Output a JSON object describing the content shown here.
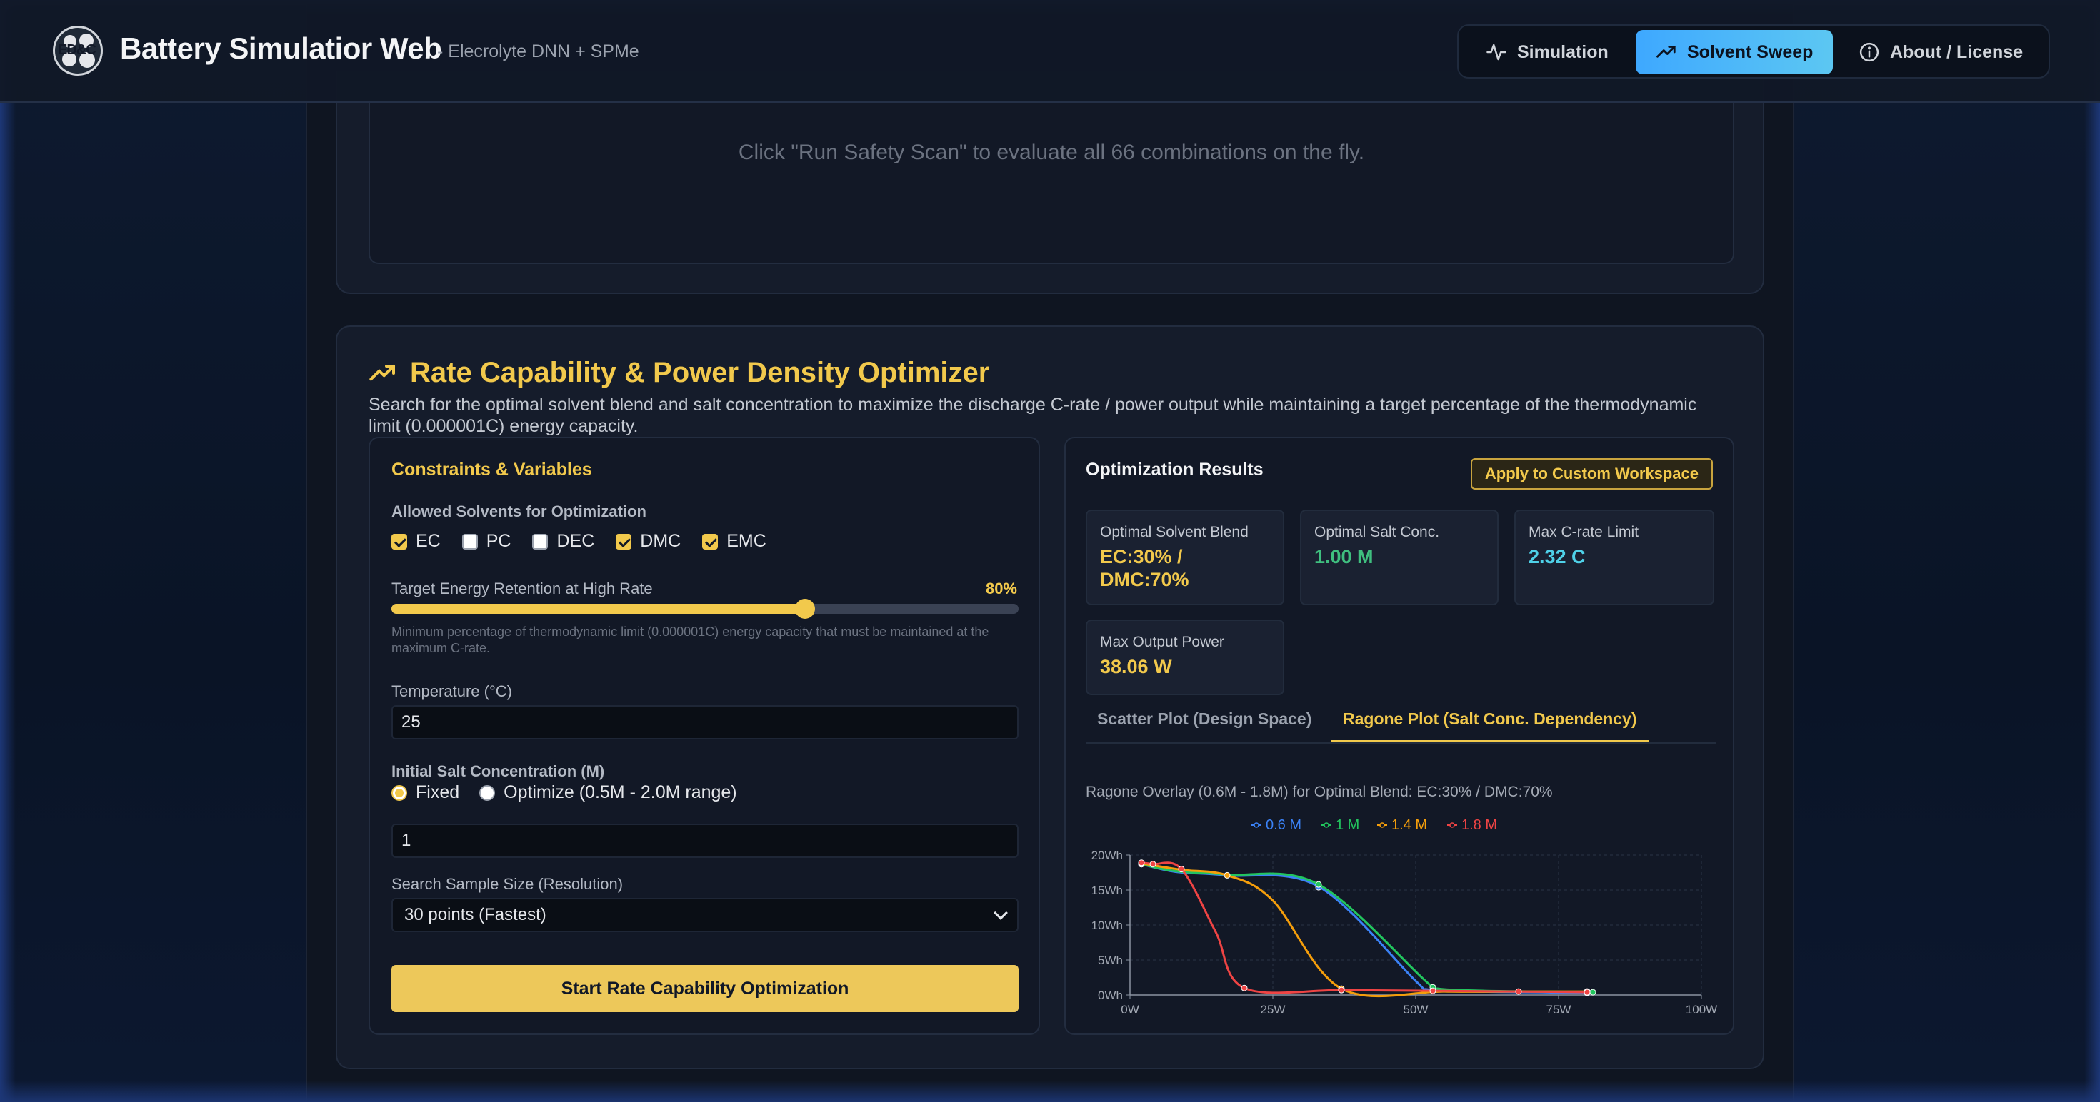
{
  "header": {
    "title": "Battery Simulatior Web",
    "subtitle": "- Elecrolyte DNN + SPMe",
    "logo_text": "ED&C"
  },
  "nav": [
    {
      "label": "Simulation",
      "icon": "pulse-icon",
      "active": false
    },
    {
      "label": "Solvent Sweep",
      "icon": "trend-up-icon",
      "active": true
    },
    {
      "label": "About / License",
      "icon": "info-icon",
      "active": false
    }
  ],
  "safety": {
    "message": "Click \"Run Safety Scan\" to evaluate all 66 combinations on the fly."
  },
  "optimizer": {
    "title": "Rate Capability & Power Density Optimizer",
    "description": "Search for the optimal solvent blend and salt concentration to maximize the discharge C-rate / power output while maintaining a target percentage of the thermodynamic limit (0.000001C) energy capacity.",
    "constraints": {
      "title": "Constraints & Variables",
      "solvents_label": "Allowed Solvents for Optimization",
      "solvents": [
        {
          "name": "EC",
          "checked": true
        },
        {
          "name": "PC",
          "checked": false
        },
        {
          "name": "DEC",
          "checked": false
        },
        {
          "name": "DMC",
          "checked": true
        },
        {
          "name": "EMC",
          "checked": true
        }
      ],
      "retention_label": "Target Energy Retention at High Rate",
      "retention_value": "80%",
      "retention_fraction": 0.66,
      "retention_help": "Minimum percentage of thermodynamic limit (0.000001C) energy capacity that must be maintained at the maximum C-rate.",
      "temperature_label": "Temperature (°C)",
      "temperature_value": "25",
      "salt_label": "Initial Salt Concentration (M)",
      "salt_modes": [
        {
          "label": "Fixed",
          "selected": true
        },
        {
          "label": "Optimize (0.5M - 2.0M range)",
          "selected": false
        }
      ],
      "salt_value": "1",
      "sample_label": "Search Sample Size (Resolution)",
      "sample_value": "30 points (Fastest)",
      "run_button": "Start Rate Capability Optimization"
    },
    "results": {
      "title": "Optimization Results",
      "apply_button": "Apply to Custom Workspace",
      "metrics": [
        {
          "label": "Optimal Solvent Blend",
          "value_line1": "EC:30% /",
          "value_line2": "DMC:70%",
          "color": "#f2c94c"
        },
        {
          "label": "Optimal Salt Conc.",
          "value_line1": "1.00 M",
          "value_line2": "",
          "color": "#3fbf7f"
        },
        {
          "label": "Max C-rate Limit",
          "value_line1": "2.32 C",
          "value_line2": "",
          "color": "#4fd1e8"
        },
        {
          "label": "Max Output Power",
          "value_line1": "38.06 W",
          "value_line2": "",
          "color": "#f2c94c"
        }
      ],
      "tabs": [
        {
          "label": "Scatter Plot (Design Space)",
          "active": false
        },
        {
          "label": "Ragone Plot (Salt Conc. Dependency)",
          "active": true
        }
      ],
      "chart_caption": "Ragone Overlay (0.6M - 1.8M) for Optimal Blend: EC:30% / DMC:70%"
    }
  },
  "chart_data": {
    "type": "line",
    "title": "Ragone Overlay (0.6M - 1.8M) for Optimal Blend: EC:30% / DMC:70%",
    "xlabel": "",
    "ylabel": "",
    "xlim": [
      0,
      100
    ],
    "ylim": [
      0,
      20
    ],
    "xticks": [
      "0W",
      "25W",
      "50W",
      "75W",
      "100W"
    ],
    "yticks": [
      "0Wh",
      "5Wh",
      "10Wh",
      "15Wh",
      "20Wh"
    ],
    "grid": true,
    "legend": "top-center",
    "series": [
      {
        "name": "0.6 M",
        "color": "#3b82f6",
        "points": [
          [
            2,
            18.7
          ],
          [
            8,
            17.6
          ],
          [
            17,
            17.1
          ],
          [
            33,
            15.5
          ],
          [
            50,
            2.0
          ],
          [
            52,
            0.8
          ],
          [
            60,
            0.5
          ],
          [
            70,
            0.4
          ],
          [
            80,
            0.3
          ]
        ]
      },
      {
        "name": "1 M",
        "color": "#22c55e",
        "points": [
          [
            2,
            18.7
          ],
          [
            8,
            17.7
          ],
          [
            17,
            17.2
          ],
          [
            33,
            15.8
          ],
          [
            52,
            1.8
          ],
          [
            54,
            0.9
          ],
          [
            62,
            0.6
          ],
          [
            72,
            0.5
          ],
          [
            81,
            0.4
          ]
        ]
      },
      {
        "name": "1.4 M",
        "color": "#f59e0b",
        "points": [
          [
            2,
            18.8
          ],
          [
            9,
            17.9
          ],
          [
            17,
            17.1
          ],
          [
            25,
            13.5
          ],
          [
            37,
            0.9
          ],
          [
            55,
            0.5
          ],
          [
            68,
            0.5
          ],
          [
            80,
            0.5
          ]
        ]
      },
      {
        "name": "1.8 M",
        "color": "#ef4444",
        "points": [
          [
            2,
            18.9
          ],
          [
            4,
            18.7
          ],
          [
            9,
            18.0
          ],
          [
            15,
            9.0
          ],
          [
            20,
            1.0
          ],
          [
            37,
            0.7
          ],
          [
            53,
            0.6
          ],
          [
            68,
            0.5
          ],
          [
            80,
            0.4
          ]
        ]
      }
    ],
    "markers": {
      "0.6 M": [
        [
          2,
          18.7
        ],
        [
          33,
          15.4
        ],
        [
          80,
          0.3
        ]
      ],
      "1 M": [
        [
          2,
          18.7
        ],
        [
          33,
          15.8
        ],
        [
          53,
          1.1
        ],
        [
          81,
          0.4
        ]
      ],
      "1.4 M": [
        [
          2,
          18.8
        ],
        [
          17,
          17.1
        ],
        [
          37,
          0.9
        ],
        [
          80,
          0.5
        ]
      ],
      "1.8 M": [
        [
          2,
          18.9
        ],
        [
          4,
          18.7
        ],
        [
          9,
          18.0
        ],
        [
          20,
          1.0
        ],
        [
          37,
          0.7
        ],
        [
          53,
          0.6
        ],
        [
          68,
          0.5
        ],
        [
          80,
          0.4
        ]
      ]
    }
  }
}
